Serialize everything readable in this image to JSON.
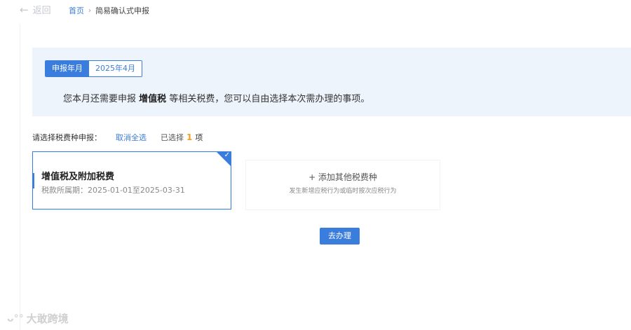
{
  "header": {
    "back_label": "返回",
    "breadcrumb": {
      "home": "首页",
      "separator": "›",
      "current": "简易确认式申报"
    }
  },
  "notice": {
    "period_label": "申报年月",
    "period_value": "2025年4月",
    "message_prefix": "您本月还需要申报",
    "message_tax": "增值税",
    "message_suffix": "等相关税费，您可以自由选择本次需办理的事项。"
  },
  "selection": {
    "prompt": "请选择税费种申报：",
    "deselect_all": "取消全选",
    "selected_prefix": "已选择",
    "selected_count": "1",
    "selected_suffix": "项"
  },
  "tax_card": {
    "title": "增值税及附加税费",
    "period": "税款所属期：2025-01-01至2025-03-31",
    "selected": true
  },
  "add_card": {
    "title": "+ 添加其他税费种",
    "subtitle": "发生新增应税行为或临时按次应税行为"
  },
  "action": {
    "go_label": "去办理"
  },
  "watermark": {
    "text": "大敢跨境"
  },
  "colors": {
    "accent": "#3b7ddd",
    "notice_bg": "#eef4fb",
    "count": "#f0a020"
  },
  "icons": {
    "back": "arrow-left-icon",
    "check": "checkmark-icon",
    "logo": "brand-logo-icon"
  }
}
